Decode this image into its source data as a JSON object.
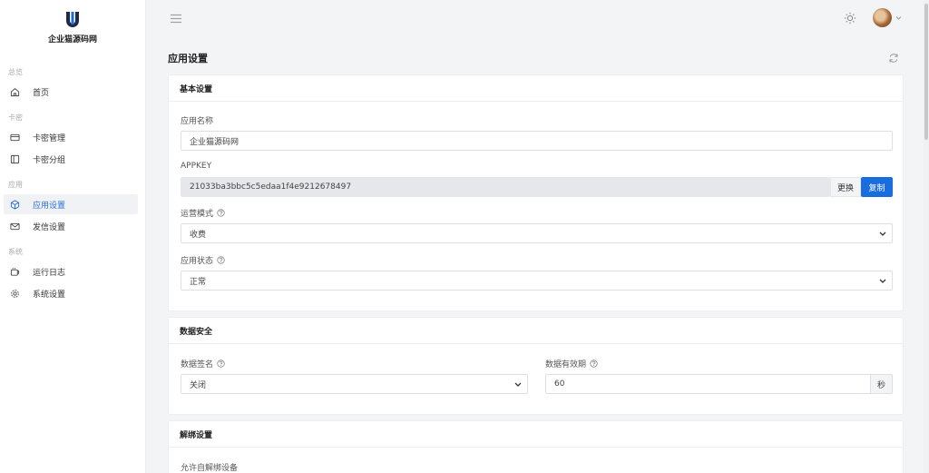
{
  "brand": {
    "name": "企业猫源码网",
    "logo_letter": "U"
  },
  "sidebar": {
    "groups": [
      {
        "label": "总览"
      },
      {
        "label": "卡密"
      },
      {
        "label": "应用"
      },
      {
        "label": "系统"
      }
    ],
    "items": [
      {
        "label": "首页",
        "icon": "home-icon"
      },
      {
        "label": "卡密管理",
        "icon": "card-icon"
      },
      {
        "label": "卡密分组",
        "icon": "sidebar-panel-icon"
      },
      {
        "label": "应用设置",
        "icon": "cube-icon",
        "active": true
      },
      {
        "label": "发信设置",
        "icon": "mail-icon"
      },
      {
        "label": "运行日志",
        "icon": "log-icon"
      },
      {
        "label": "系统设置",
        "icon": "gear-icon"
      }
    ]
  },
  "page": {
    "title": "应用设置"
  },
  "basic": {
    "header": "基本设置",
    "app_name_label": "应用名称",
    "app_name_value": "企业猫源码网",
    "appkey_label": "APPKEY",
    "appkey_value": "21033ba3bbc5c5edaa1f4e9212678497",
    "replace_label": "更换",
    "copy_label": "复制",
    "mode_label": "运营模式",
    "mode_value": "收费",
    "status_label": "应用状态",
    "status_value": "正常"
  },
  "security": {
    "header": "数据安全",
    "sign_label": "数据签名",
    "sign_value": "关闭",
    "expire_label": "数据有效期",
    "expire_value": "60",
    "expire_unit": "秒"
  },
  "unbind": {
    "header": "解绑设置",
    "self_unbind_label": "允许自解绑设备"
  },
  "colors": {
    "accent": "#1a6ddf",
    "active_text": "#2d6ddb"
  }
}
